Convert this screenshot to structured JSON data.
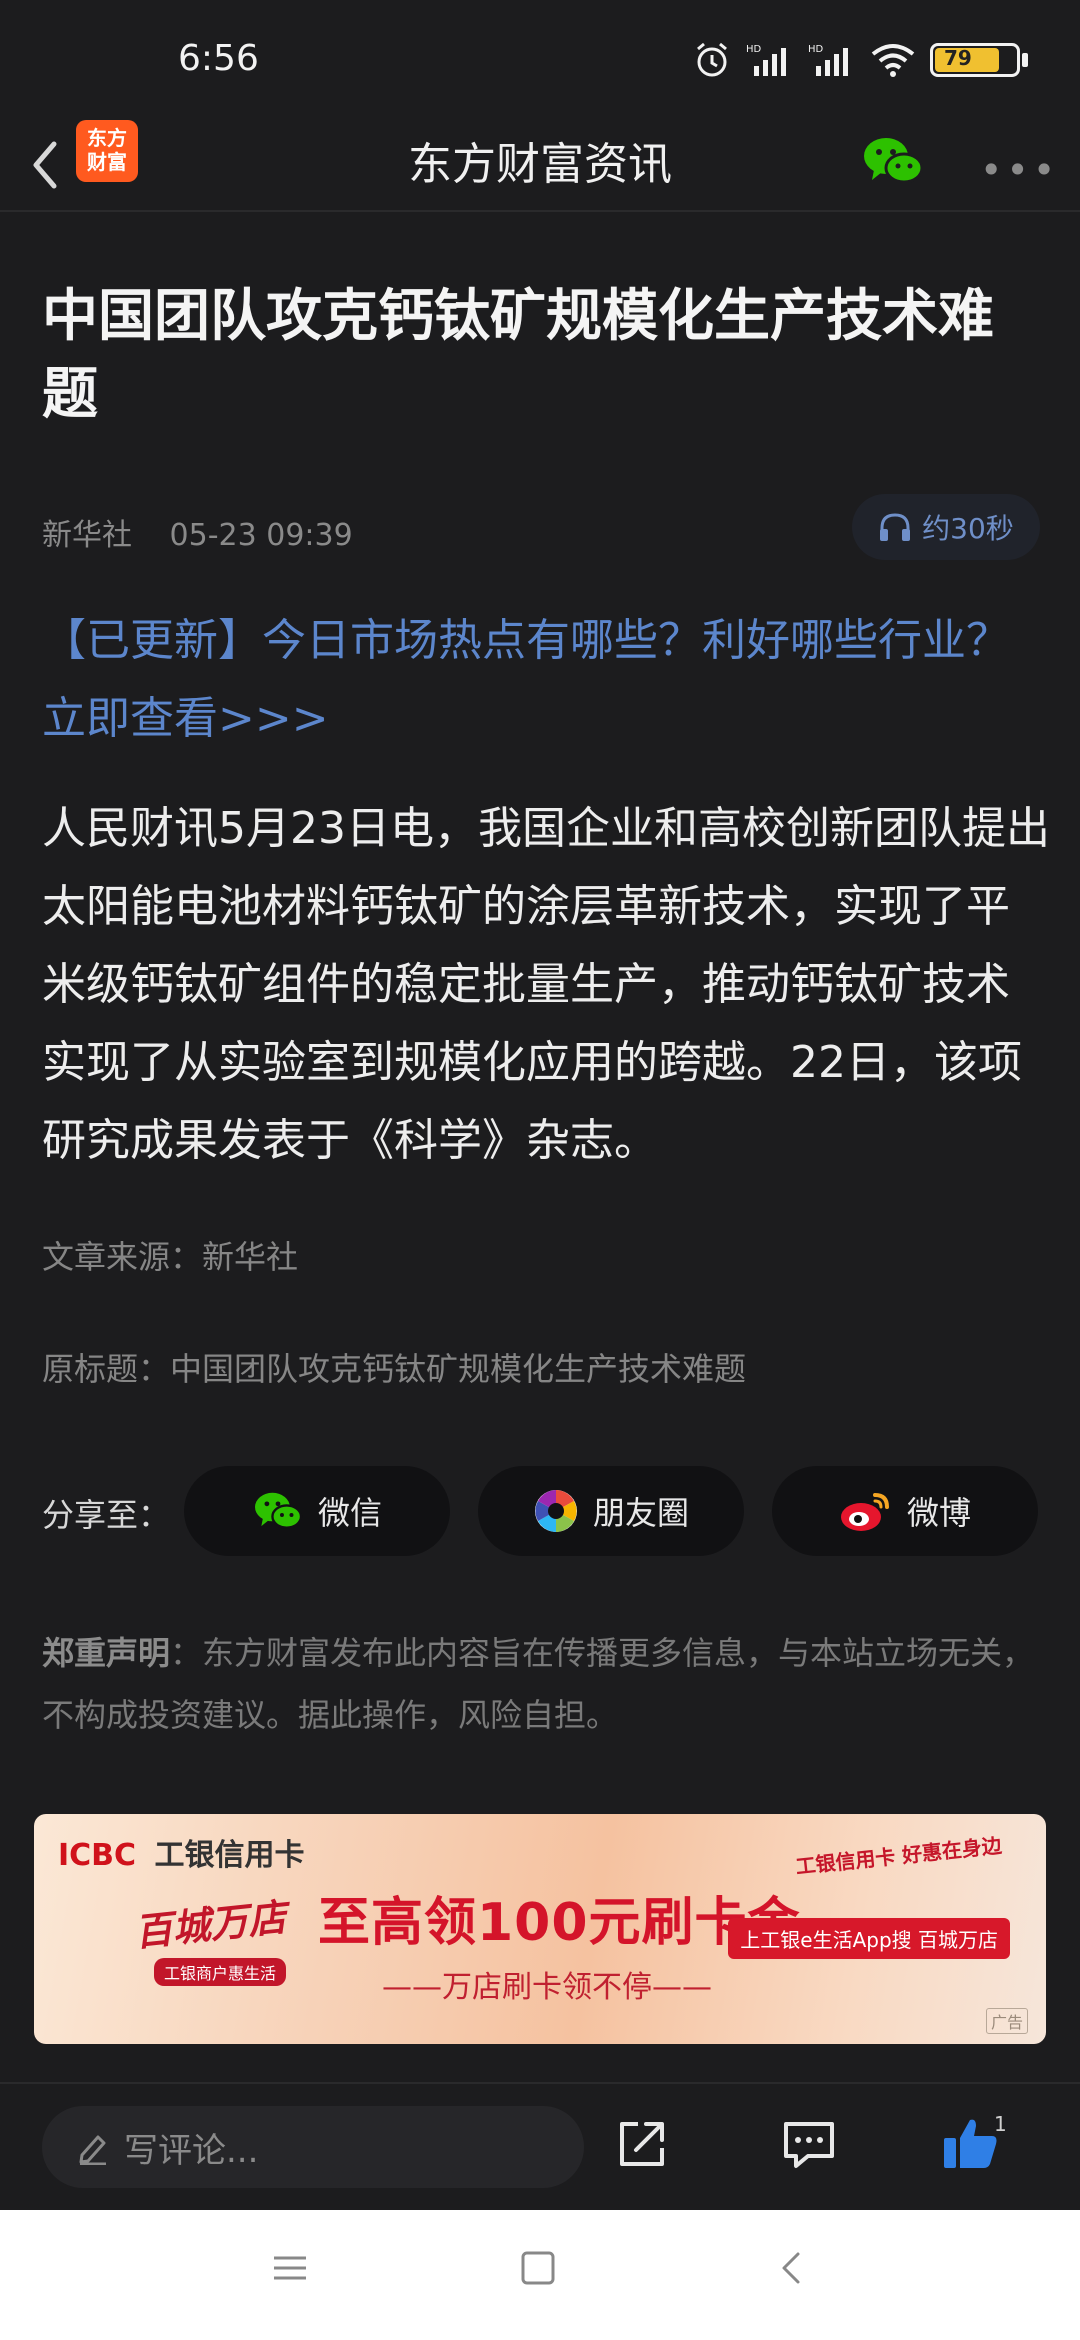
{
  "status_bar": {
    "time": "6:56",
    "battery": "79"
  },
  "nav": {
    "title": "东方财富资讯",
    "logo_text": "东方\n财富",
    "more": "•••"
  },
  "article": {
    "title": "中国团队攻克钙钛矿规模化生产技术难题",
    "source": "新华社",
    "datetime": "05-23 09:39",
    "listen_label": "约30秒",
    "promo": "【已更新】今日市场热点有哪些？利好哪些行业？立即查看>>>",
    "body": "人民财讯5月23日电，我国企业和高校创新团队提出太阳能电池材料钙钛矿的涂层革新技术，实现了平米级钙钛矿组件的稳定批量生产，推动钙钛矿技术实现了从实验室到规模化应用的跨越。22日，该项研究成果发表于《科学》杂志。",
    "source_line": "文章来源：新华社",
    "orig_title_line": "原标题：中国团队攻克钙钛矿规模化生产技术难题"
  },
  "share": {
    "label": "分享至：",
    "wechat": "微信",
    "moments": "朋友圈",
    "weibo": "微博"
  },
  "disclaimer": {
    "title": "郑重声明",
    "text": "：东方财富发布此内容旨在传播更多信息，与本站立场无关，不构成投资建议。据此操作，风险自担。"
  },
  "ad": {
    "brand_icbc": "ICBC",
    "brand_name": "工银信用卡",
    "left_title": "百城万店",
    "left_sub": "工银商户惠生活",
    "headline": "至高领100元刷卡金",
    "subline": "——万店刷卡领不停——",
    "tag": "上工银e生活App搜 百城万店",
    "corner": "工银信用卡 好惠在身边",
    "mark": "广告"
  },
  "bottom": {
    "comment_placeholder": "写评论...",
    "like_count": "1"
  },
  "colors": {
    "accent_link": "#5c86cc",
    "logo_orange": "#ff5a1f",
    "wechat_green": "#2dc100",
    "like_blue": "#2f7fe6"
  }
}
